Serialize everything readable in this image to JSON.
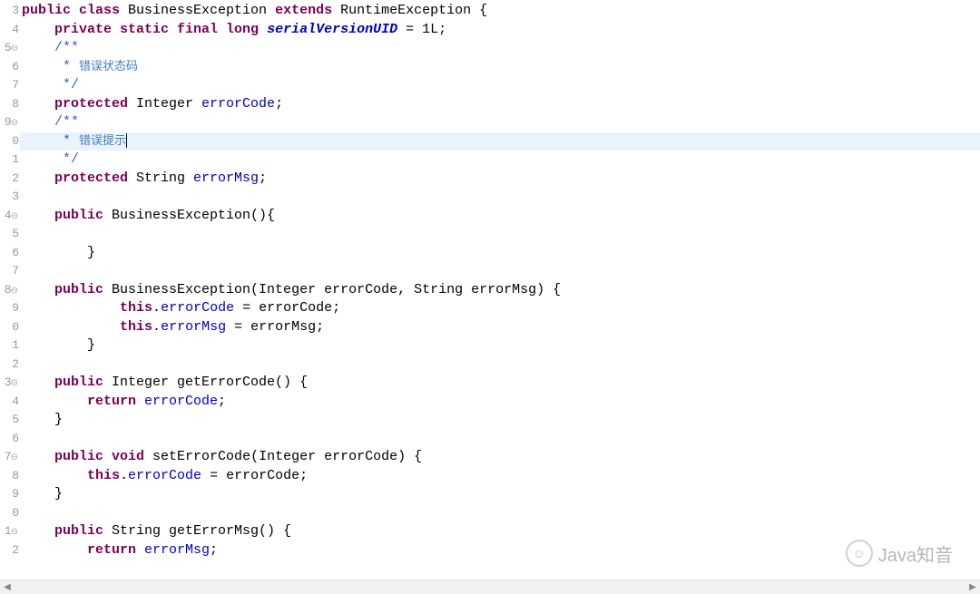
{
  "watermark": {
    "icon_label": "☺",
    "text": "Java知音"
  },
  "gutter": [
    "3",
    "4",
    "5⊖",
    "6",
    "7",
    "8",
    "9⊖",
    "0",
    "1",
    "2",
    "3",
    "4⊖",
    "5",
    "6",
    "7",
    "8⊖",
    "9",
    "0",
    "1",
    "2",
    "3⊖",
    "4",
    "5",
    "6",
    "7⊖",
    "8",
    "9",
    "0",
    "1⊖",
    "2"
  ],
  "lines": [
    {
      "n": 0,
      "indent": 0,
      "tokens": [
        {
          "t": "public ",
          "c": "kw"
        },
        {
          "t": "class ",
          "c": "kw"
        },
        {
          "t": "BusinessException ",
          "c": "type"
        },
        {
          "t": "extends ",
          "c": "kw"
        },
        {
          "t": "RuntimeException ",
          "c": "type"
        },
        {
          "t": "{",
          "c": "punct"
        }
      ]
    },
    {
      "n": 1,
      "indent": 1,
      "tokens": [
        {
          "t": "private static final long ",
          "c": "kw"
        },
        {
          "t": "serialVersionUID",
          "c": "staticf"
        },
        {
          "t": " = ",
          "c": "punct"
        },
        {
          "t": "1L",
          "c": "num"
        },
        {
          "t": ";",
          "c": "punct"
        }
      ]
    },
    {
      "n": 2,
      "indent": 1,
      "tokens": [
        {
          "t": "/**",
          "c": "cmt"
        }
      ]
    },
    {
      "n": 3,
      "indent": 1,
      "tokens": [
        {
          "t": " * ",
          "c": "cmt"
        },
        {
          "t": "错误状态码",
          "c": "cmt-cn"
        }
      ]
    },
    {
      "n": 4,
      "indent": 1,
      "tokens": [
        {
          "t": " */",
          "c": "cmt"
        }
      ]
    },
    {
      "n": 5,
      "indent": 1,
      "tokens": [
        {
          "t": "protected ",
          "c": "kw"
        },
        {
          "t": "Integer ",
          "c": "type"
        },
        {
          "t": "errorCode",
          "c": "field"
        },
        {
          "t": ";",
          "c": "punct"
        }
      ]
    },
    {
      "n": 6,
      "indent": 1,
      "tokens": [
        {
          "t": "/**",
          "c": "cmt"
        }
      ]
    },
    {
      "n": 7,
      "indent": 1,
      "hl": true,
      "tokens": [
        {
          "t": " * ",
          "c": "cmt"
        },
        {
          "t": "错误提示",
          "c": "cmt-cn"
        },
        {
          "t": "",
          "caret": true
        }
      ]
    },
    {
      "n": 8,
      "indent": 1,
      "tokens": [
        {
          "t": " */",
          "c": "cmt"
        }
      ]
    },
    {
      "n": 9,
      "indent": 1,
      "tokens": [
        {
          "t": "protected ",
          "c": "kw"
        },
        {
          "t": "String ",
          "c": "type"
        },
        {
          "t": "errorMsg",
          "c": "field"
        },
        {
          "t": ";",
          "c": "punct"
        }
      ]
    },
    {
      "n": 10,
      "indent": 0,
      "tokens": []
    },
    {
      "n": 11,
      "indent": 1,
      "tokens": [
        {
          "t": "public ",
          "c": "kw"
        },
        {
          "t": "BusinessException(){",
          "c": "type"
        }
      ]
    },
    {
      "n": 12,
      "indent": 0,
      "tokens": []
    },
    {
      "n": 13,
      "indent": 2,
      "tokens": [
        {
          "t": "}",
          "c": "punct"
        }
      ]
    },
    {
      "n": 14,
      "indent": 0,
      "tokens": []
    },
    {
      "n": 15,
      "indent": 1,
      "tokens": [
        {
          "t": "public ",
          "c": "kw"
        },
        {
          "t": "BusinessException(Integer errorCode, String errorMsg) {",
          "c": "type"
        }
      ]
    },
    {
      "n": 16,
      "indent": 3,
      "tokens": [
        {
          "t": "this",
          "c": "kw"
        },
        {
          "t": ".",
          "c": "punct"
        },
        {
          "t": "errorCode",
          "c": "field"
        },
        {
          "t": " = errorCode;",
          "c": "punct"
        }
      ]
    },
    {
      "n": 17,
      "indent": 3,
      "tokens": [
        {
          "t": "this",
          "c": "kw"
        },
        {
          "t": ".",
          "c": "punct"
        },
        {
          "t": "errorMsg",
          "c": "field"
        },
        {
          "t": " = errorMsg;",
          "c": "punct"
        }
      ]
    },
    {
      "n": 18,
      "indent": 2,
      "tokens": [
        {
          "t": "}",
          "c": "punct"
        }
      ]
    },
    {
      "n": 19,
      "indent": 0,
      "tokens": []
    },
    {
      "n": 20,
      "indent": 1,
      "tokens": [
        {
          "t": "public ",
          "c": "kw"
        },
        {
          "t": "Integer getErrorCode() {",
          "c": "type"
        }
      ]
    },
    {
      "n": 21,
      "indent": 2,
      "tokens": [
        {
          "t": "return ",
          "c": "kw"
        },
        {
          "t": "errorCode",
          "c": "field"
        },
        {
          "t": ";",
          "c": "punct"
        }
      ]
    },
    {
      "n": 22,
      "indent": 1,
      "tokens": [
        {
          "t": "}",
          "c": "punct"
        }
      ]
    },
    {
      "n": 23,
      "indent": 0,
      "tokens": []
    },
    {
      "n": 24,
      "indent": 1,
      "tokens": [
        {
          "t": "public void ",
          "c": "kw"
        },
        {
          "t": "setErrorCode(Integer errorCode) {",
          "c": "type"
        }
      ]
    },
    {
      "n": 25,
      "indent": 2,
      "tokens": [
        {
          "t": "this",
          "c": "kw"
        },
        {
          "t": ".",
          "c": "punct"
        },
        {
          "t": "errorCode",
          "c": "field"
        },
        {
          "t": " = errorCode;",
          "c": "punct"
        }
      ]
    },
    {
      "n": 26,
      "indent": 1,
      "tokens": [
        {
          "t": "}",
          "c": "punct"
        }
      ]
    },
    {
      "n": 27,
      "indent": 0,
      "tokens": []
    },
    {
      "n": 28,
      "indent": 1,
      "tokens": [
        {
          "t": "public ",
          "c": "kw"
        },
        {
          "t": "String getErrorMsg() {",
          "c": "type"
        }
      ]
    },
    {
      "n": 29,
      "indent": 2,
      "tokens": [
        {
          "t": "return ",
          "c": "kw"
        },
        {
          "t": "errorMsg",
          "c": "field"
        },
        {
          "t": ";",
          "c": "punct"
        }
      ]
    }
  ]
}
